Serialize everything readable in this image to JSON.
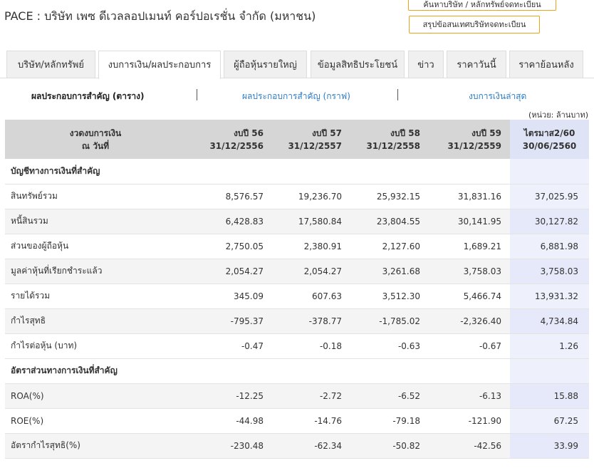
{
  "page_title": "PACE : บริษัท เพซ ดีเวลลอปเมนท์ คอร์ปอเรชั่น จำกัด (มหาชน)",
  "header_buttons": {
    "search_company": "ค้นหาบริษัท / หลักทรัพย์จดทะเบียน",
    "listed_summary": "สรุปข้อสนเทศบริษัทจดทะเบียน"
  },
  "tabs": [
    {
      "label": "บริษัท/หลักทรัพย์"
    },
    {
      "label": "งบการเงิน/ผลประกอบการ"
    },
    {
      "label": "ผู้ถือหุ้นรายใหญ่"
    },
    {
      "label": "ข้อมูลสิทธิประโยชน์"
    },
    {
      "label": "ข่าว"
    },
    {
      "label": "ราคาวันนี้"
    },
    {
      "label": "ราคาย้อนหลัง"
    }
  ],
  "active_tab": "งบการเงิน/ผลประกอบการ",
  "subnav": {
    "current": "ผลประกอบการสำคัญ (ตาราง)",
    "graph_link": "ผลประกอบการสำคัญ (กราฟ)",
    "latest_link": "งบการเงินล่าสุด"
  },
  "unit_note": "(หน่วย: ล้านบาท)",
  "table": {
    "header_first_line1": "งวดงบการเงิน",
    "header_first_line2": "ณ วันที่",
    "columns": [
      {
        "line1": "งบปี 56",
        "line2": "31/12/2556"
      },
      {
        "line1": "งบปี 57",
        "line2": "31/12/2557"
      },
      {
        "line1": "งบปี 58",
        "line2": "31/12/2558"
      },
      {
        "line1": "งบปี 59",
        "line2": "31/12/2559"
      },
      {
        "line1": "ไตรมาส2/60",
        "line2": "30/06/2560"
      }
    ],
    "rows": [
      {
        "section": true,
        "label": "บัญชีทางการเงินที่สำคัญ",
        "values": [
          "",
          "",
          "",
          "",
          ""
        ]
      },
      {
        "label": "สินทรัพย์รวม",
        "values": [
          "8,576.57",
          "19,236.70",
          "25,932.15",
          "31,831.16",
          "37,025.95"
        ]
      },
      {
        "label": "หนี้สินรวม",
        "values": [
          "6,428.83",
          "17,580.84",
          "23,804.55",
          "30,141.95",
          "30,127.82"
        ]
      },
      {
        "label": "ส่วนของผู้ถือหุ้น",
        "values": [
          "2,750.05",
          "2,380.91",
          "2,127.60",
          "1,689.21",
          "6,881.98"
        ]
      },
      {
        "label": "มูลค่าหุ้นที่เรียกชำระแล้ว",
        "values": [
          "2,054.27",
          "2,054.27",
          "3,261.68",
          "3,758.03",
          "3,758.03"
        ]
      },
      {
        "label": "รายได้รวม",
        "values": [
          "345.09",
          "607.63",
          "3,512.30",
          "5,466.74",
          "13,931.32"
        ]
      },
      {
        "label": "กำไรสุทธิ",
        "values": [
          "-795.37",
          "-378.77",
          "-1,785.02",
          "-2,326.40",
          "4,734.84"
        ]
      },
      {
        "label": "กำไรต่อหุ้น (บาท)",
        "values": [
          "-0.47",
          "-0.18",
          "-0.63",
          "-0.67",
          "1.26"
        ]
      },
      {
        "section": true,
        "label": "อัตราส่วนทางการเงินที่สำคัญ",
        "values": [
          "",
          "",
          "",
          "",
          ""
        ]
      },
      {
        "label": "ROA(%)",
        "values": [
          "-12.25",
          "-2.72",
          "-6.52",
          "-6.13",
          "15.88"
        ]
      },
      {
        "label": "ROE(%)",
        "values": [
          "-44.98",
          "-14.76",
          "-79.18",
          "-121.90",
          "67.25"
        ]
      },
      {
        "label": "อัตรากำไรสุทธิ(%)",
        "values": [
          "-230.48",
          "-62.34",
          "-50.82",
          "-42.56",
          "33.99"
        ]
      }
    ]
  },
  "colors": {
    "accent_border": "#e8a317",
    "link": "#2e7bc4",
    "header_bg": "#d6d6d6",
    "highlight_col": "#eef0fc"
  }
}
